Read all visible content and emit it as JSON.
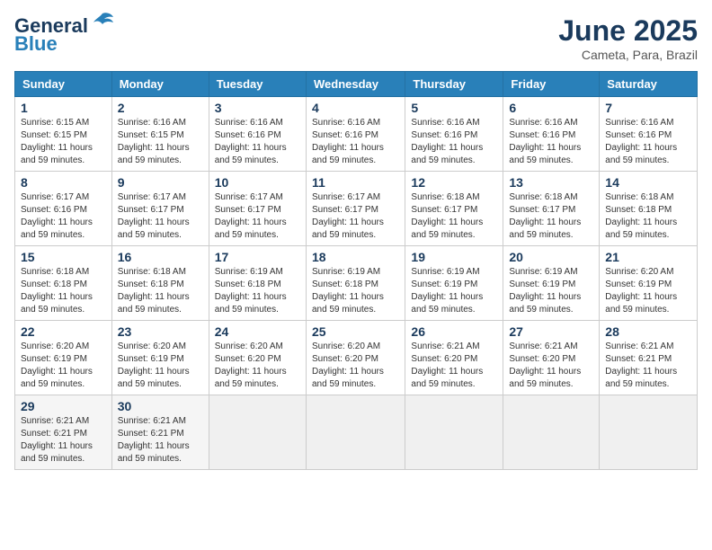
{
  "logo": {
    "text1": "General",
    "text2": "Blue"
  },
  "title": "June 2025",
  "location": "Cameta, Para, Brazil",
  "days_of_week": [
    "Sunday",
    "Monday",
    "Tuesday",
    "Wednesday",
    "Thursday",
    "Friday",
    "Saturday"
  ],
  "weeks": [
    [
      {
        "day": "1",
        "sunrise": "6:15 AM",
        "sunset": "6:15 PM",
        "daylight": "11 hours and 59 minutes."
      },
      {
        "day": "2",
        "sunrise": "6:16 AM",
        "sunset": "6:15 PM",
        "daylight": "11 hours and 59 minutes."
      },
      {
        "day": "3",
        "sunrise": "6:16 AM",
        "sunset": "6:16 PM",
        "daylight": "11 hours and 59 minutes."
      },
      {
        "day": "4",
        "sunrise": "6:16 AM",
        "sunset": "6:16 PM",
        "daylight": "11 hours and 59 minutes."
      },
      {
        "day": "5",
        "sunrise": "6:16 AM",
        "sunset": "6:16 PM",
        "daylight": "11 hours and 59 minutes."
      },
      {
        "day": "6",
        "sunrise": "6:16 AM",
        "sunset": "6:16 PM",
        "daylight": "11 hours and 59 minutes."
      },
      {
        "day": "7",
        "sunrise": "6:16 AM",
        "sunset": "6:16 PM",
        "daylight": "11 hours and 59 minutes."
      }
    ],
    [
      {
        "day": "8",
        "sunrise": "6:17 AM",
        "sunset": "6:16 PM",
        "daylight": "11 hours and 59 minutes."
      },
      {
        "day": "9",
        "sunrise": "6:17 AM",
        "sunset": "6:17 PM",
        "daylight": "11 hours and 59 minutes."
      },
      {
        "day": "10",
        "sunrise": "6:17 AM",
        "sunset": "6:17 PM",
        "daylight": "11 hours and 59 minutes."
      },
      {
        "day": "11",
        "sunrise": "6:17 AM",
        "sunset": "6:17 PM",
        "daylight": "11 hours and 59 minutes."
      },
      {
        "day": "12",
        "sunrise": "6:18 AM",
        "sunset": "6:17 PM",
        "daylight": "11 hours and 59 minutes."
      },
      {
        "day": "13",
        "sunrise": "6:18 AM",
        "sunset": "6:17 PM",
        "daylight": "11 hours and 59 minutes."
      },
      {
        "day": "14",
        "sunrise": "6:18 AM",
        "sunset": "6:18 PM",
        "daylight": "11 hours and 59 minutes."
      }
    ],
    [
      {
        "day": "15",
        "sunrise": "6:18 AM",
        "sunset": "6:18 PM",
        "daylight": "11 hours and 59 minutes."
      },
      {
        "day": "16",
        "sunrise": "6:18 AM",
        "sunset": "6:18 PM",
        "daylight": "11 hours and 59 minutes."
      },
      {
        "day": "17",
        "sunrise": "6:19 AM",
        "sunset": "6:18 PM",
        "daylight": "11 hours and 59 minutes."
      },
      {
        "day": "18",
        "sunrise": "6:19 AM",
        "sunset": "6:18 PM",
        "daylight": "11 hours and 59 minutes."
      },
      {
        "day": "19",
        "sunrise": "6:19 AM",
        "sunset": "6:19 PM",
        "daylight": "11 hours and 59 minutes."
      },
      {
        "day": "20",
        "sunrise": "6:19 AM",
        "sunset": "6:19 PM",
        "daylight": "11 hours and 59 minutes."
      },
      {
        "day": "21",
        "sunrise": "6:20 AM",
        "sunset": "6:19 PM",
        "daylight": "11 hours and 59 minutes."
      }
    ],
    [
      {
        "day": "22",
        "sunrise": "6:20 AM",
        "sunset": "6:19 PM",
        "daylight": "11 hours and 59 minutes."
      },
      {
        "day": "23",
        "sunrise": "6:20 AM",
        "sunset": "6:19 PM",
        "daylight": "11 hours and 59 minutes."
      },
      {
        "day": "24",
        "sunrise": "6:20 AM",
        "sunset": "6:20 PM",
        "daylight": "11 hours and 59 minutes."
      },
      {
        "day": "25",
        "sunrise": "6:20 AM",
        "sunset": "6:20 PM",
        "daylight": "11 hours and 59 minutes."
      },
      {
        "day": "26",
        "sunrise": "6:21 AM",
        "sunset": "6:20 PM",
        "daylight": "11 hours and 59 minutes."
      },
      {
        "day": "27",
        "sunrise": "6:21 AM",
        "sunset": "6:20 PM",
        "daylight": "11 hours and 59 minutes."
      },
      {
        "day": "28",
        "sunrise": "6:21 AM",
        "sunset": "6:21 PM",
        "daylight": "11 hours and 59 minutes."
      }
    ],
    [
      {
        "day": "29",
        "sunrise": "6:21 AM",
        "sunset": "6:21 PM",
        "daylight": "11 hours and 59 minutes."
      },
      {
        "day": "30",
        "sunrise": "6:21 AM",
        "sunset": "6:21 PM",
        "daylight": "11 hours and 59 minutes."
      },
      null,
      null,
      null,
      null,
      null
    ]
  ]
}
